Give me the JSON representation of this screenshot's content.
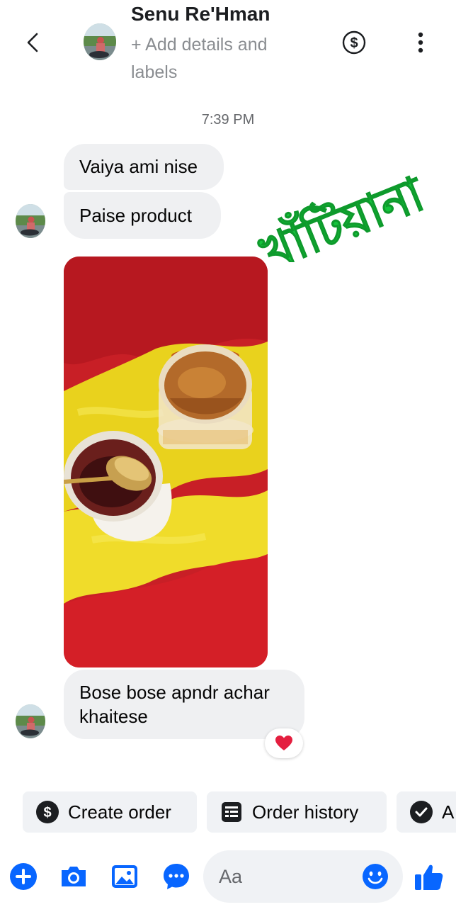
{
  "header": {
    "contact_name": "Senu Re'Hman",
    "add_details": "+ Add details and labels",
    "back_icon": "chevron-left-icon",
    "payment_icon": "dollar-circle-icon",
    "more_icon": "vertical-dots-icon"
  },
  "conversation": {
    "timestamp": "7:39 PM",
    "messages": [
      {
        "text": "Vaiya ami nise"
      },
      {
        "text": "Paise product"
      },
      {
        "text": "Bose bose apndr achar khaitese",
        "reaction": "heart"
      }
    ],
    "watermark": "খাঁটিয়ানা"
  },
  "quick_actions": [
    {
      "label": "Create order",
      "icon": "dollar-circle-icon"
    },
    {
      "label": "Order history",
      "icon": "receipt-icon"
    },
    {
      "label": "A",
      "icon": "check-circle-icon"
    }
  ],
  "composer": {
    "placeholder": "Aa",
    "icons": [
      "plus-icon",
      "camera-icon",
      "image-icon",
      "chat-bubble-icon",
      "emoji-icon",
      "thumbs-up-icon"
    ]
  },
  "colors": {
    "accent": "#0866ff",
    "watermark": "#14c43b",
    "bubble": "#eff0f2"
  }
}
